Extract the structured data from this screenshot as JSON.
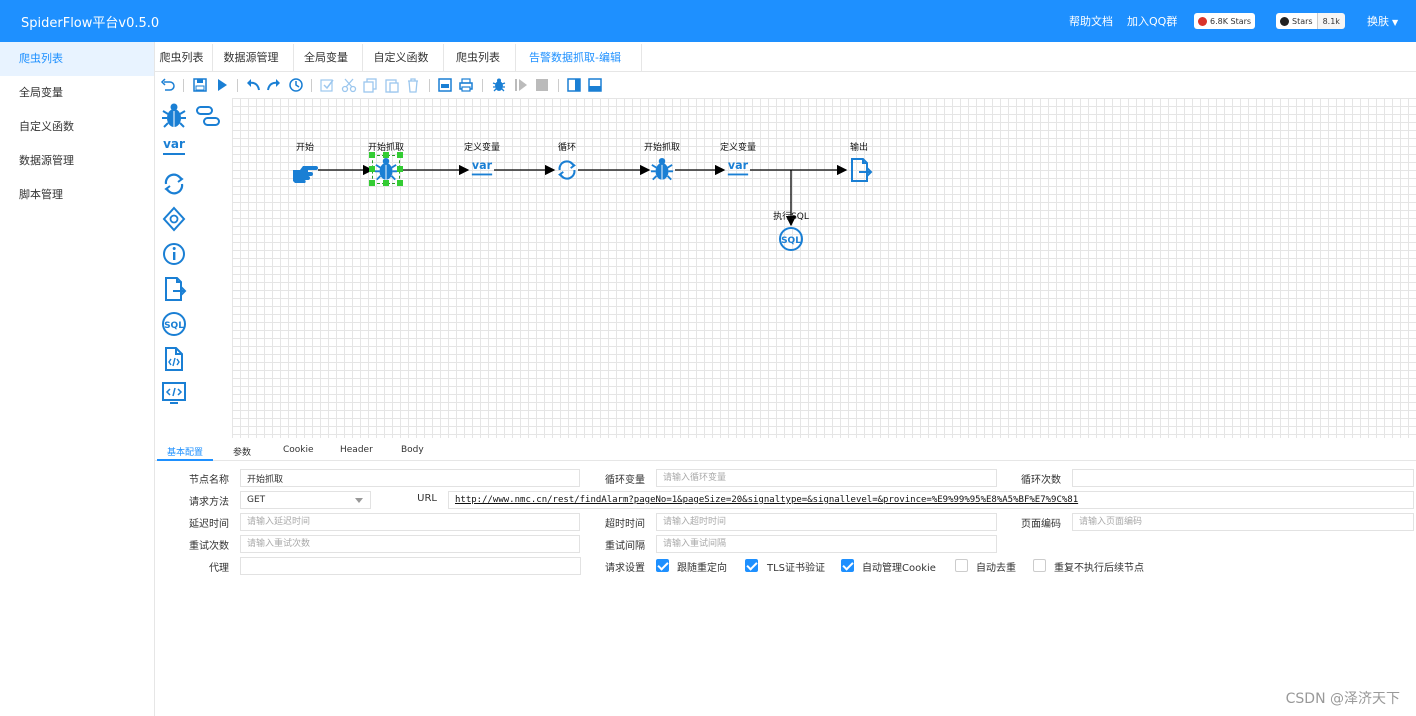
{
  "header": {
    "brand": "SpiderFlow平台v0.5.0",
    "help": "帮助文档",
    "qq": "加入QQ群",
    "gitee_stars": "6.8K Stars",
    "github_label": "Stars",
    "github_count": "8.1k",
    "skin": "换肤"
  },
  "sidebar": {
    "items": [
      {
        "label": "爬虫列表"
      },
      {
        "label": "全局变量"
      },
      {
        "label": "自定义函数"
      },
      {
        "label": "数据源管理"
      },
      {
        "label": "脚本管理"
      }
    ]
  },
  "tabs": [
    {
      "label": "爬虫列表"
    },
    {
      "label": "数据源管理"
    },
    {
      "label": "全局变量"
    },
    {
      "label": "自定义函数"
    },
    {
      "label": "爬虫列表"
    },
    {
      "label": "告警数据抓取-编辑"
    }
  ],
  "canvas": {
    "nodes": [
      {
        "label": "开始",
        "icon": "hand-pointer-icon"
      },
      {
        "label": "开始抓取",
        "icon": "spider-icon"
      },
      {
        "label": "定义变量",
        "icon": "var-icon"
      },
      {
        "label": "循环",
        "icon": "loop-icon"
      },
      {
        "label": "开始抓取",
        "icon": "spider-icon"
      },
      {
        "label": "定义变量",
        "icon": "var-icon"
      },
      {
        "label": "输出",
        "icon": "output-icon"
      },
      {
        "label": "执行SQL",
        "icon": "sql-icon"
      }
    ]
  },
  "palette": {
    "var_text": "var",
    "sql_text": "SQL"
  },
  "prop_tabs": [
    {
      "label": "基本配置"
    },
    {
      "label": "参数"
    },
    {
      "label": "Cookie"
    },
    {
      "label": "Header"
    },
    {
      "label": "Body"
    }
  ],
  "form": {
    "node_name_label": "节点名称",
    "node_name_value": "开始抓取",
    "loop_var_label": "循环变量",
    "loop_var_placeholder": "请输入循环变量",
    "loop_count_label": "循环次数",
    "method_label": "请求方法",
    "method_value": "GET",
    "url_label": "URL",
    "url_value": "http://www.nmc.cn/rest/findAlarm?pageNo=1&pageSize=20&signaltype=&signallevel=&province=%E9%99%95%E8%A5%BF%E7%9C%81",
    "delay_label": "延迟时间",
    "delay_placeholder": "请输入延迟时间",
    "timeout_label": "超时时间",
    "timeout_placeholder": "请输入超时时间",
    "encoding_label": "页面编码",
    "encoding_placeholder": "请输入页面编码",
    "retry_label": "重试次数",
    "retry_placeholder": "请输入重试次数",
    "retry_interval_label": "重试间隔",
    "retry_interval_placeholder": "请输入重试间隔",
    "proxy_label": "代理",
    "request_settings_label": "请求设置",
    "options": [
      {
        "label": "跟随重定向",
        "checked": true
      },
      {
        "label": "TLS证书验证",
        "checked": true
      },
      {
        "label": "自动管理Cookie",
        "checked": true
      },
      {
        "label": "自动去重",
        "checked": false
      },
      {
        "label": "重复不执行后续节点",
        "checked": false
      }
    ]
  },
  "colors": {
    "primary": "#1e90ff",
    "icon_blue": "#1a7fd4"
  },
  "watermark": "CSDN @泽济天下"
}
